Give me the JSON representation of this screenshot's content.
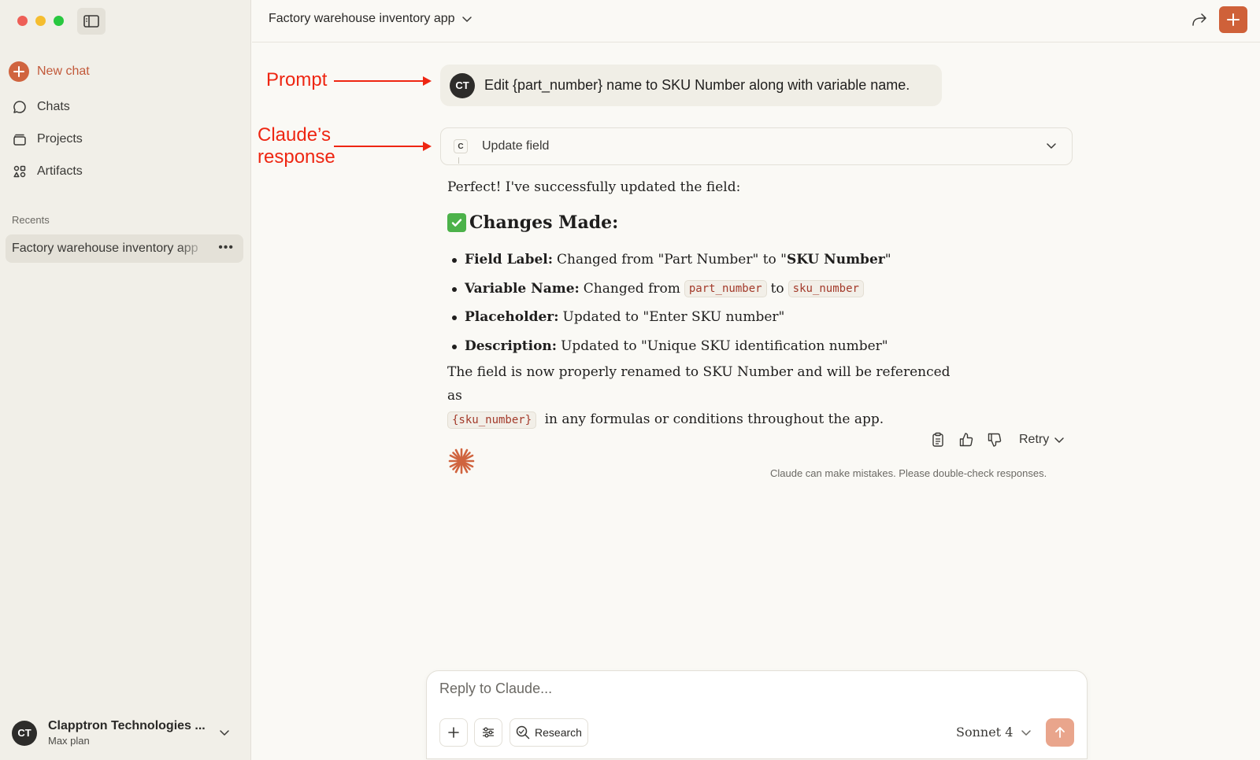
{
  "sidebar": {
    "new_chat": "New chat",
    "nav": [
      {
        "label": "Chats",
        "icon": "chat-bubble-icon"
      },
      {
        "label": "Projects",
        "icon": "projects-icon"
      },
      {
        "label": "Artifacts",
        "icon": "artifacts-icon"
      }
    ],
    "recents_label": "Recents",
    "recents": [
      {
        "label": "Factory warehouse inventory app"
      }
    ],
    "account": {
      "initials": "CT",
      "name": "Clapptron Technologies ...",
      "plan": "Max plan"
    }
  },
  "header": {
    "title": "Factory warehouse inventory app"
  },
  "annotations": {
    "prompt_label": "Prompt",
    "response_label_line1": "Claude’s",
    "response_label_line2": "response",
    "color": "#ee2612"
  },
  "conversation": {
    "user_initials": "CT",
    "prompt": "Edit {part_number} name to SKU Number along with variable name.",
    "tool": {
      "icon_letter": "C",
      "label": "Update field"
    },
    "response": {
      "intro": "Perfect! I've successfully updated the field:",
      "heading": "Changes Made:",
      "bullets": [
        {
          "key": "Field Label:",
          "text_before": "Changed from \"Part Number\" to \"",
          "bold": "SKU Number",
          "text_after": "\""
        },
        {
          "key": "Variable Name:",
          "text_before": "Changed from",
          "code1": "part_number",
          "mid": "to",
          "code2": "sku_number"
        },
        {
          "key": "Placeholder:",
          "text": "Updated to \"Enter SKU number\""
        },
        {
          "key": "Description:",
          "text": "Updated to \"Unique SKU identification number\""
        }
      ],
      "closing_before": "The field is now properly renamed to SKU Number and will be referenced as",
      "closing_code": "{sku_number}",
      "closing_after": "in any formulas or conditions throughout the app."
    },
    "actions": {
      "retry": "Retry"
    },
    "disclaimer": "Claude can make mistakes. Please double-check responses."
  },
  "composer": {
    "placeholder": "Reply to Claude...",
    "research": "Research",
    "model": "Sonnet 4"
  },
  "colors": {
    "accent": "#cf6139",
    "send_disabled": "#e9a58c",
    "sidebar_bg": "#f1efe8",
    "main_bg": "#faf9f5"
  }
}
